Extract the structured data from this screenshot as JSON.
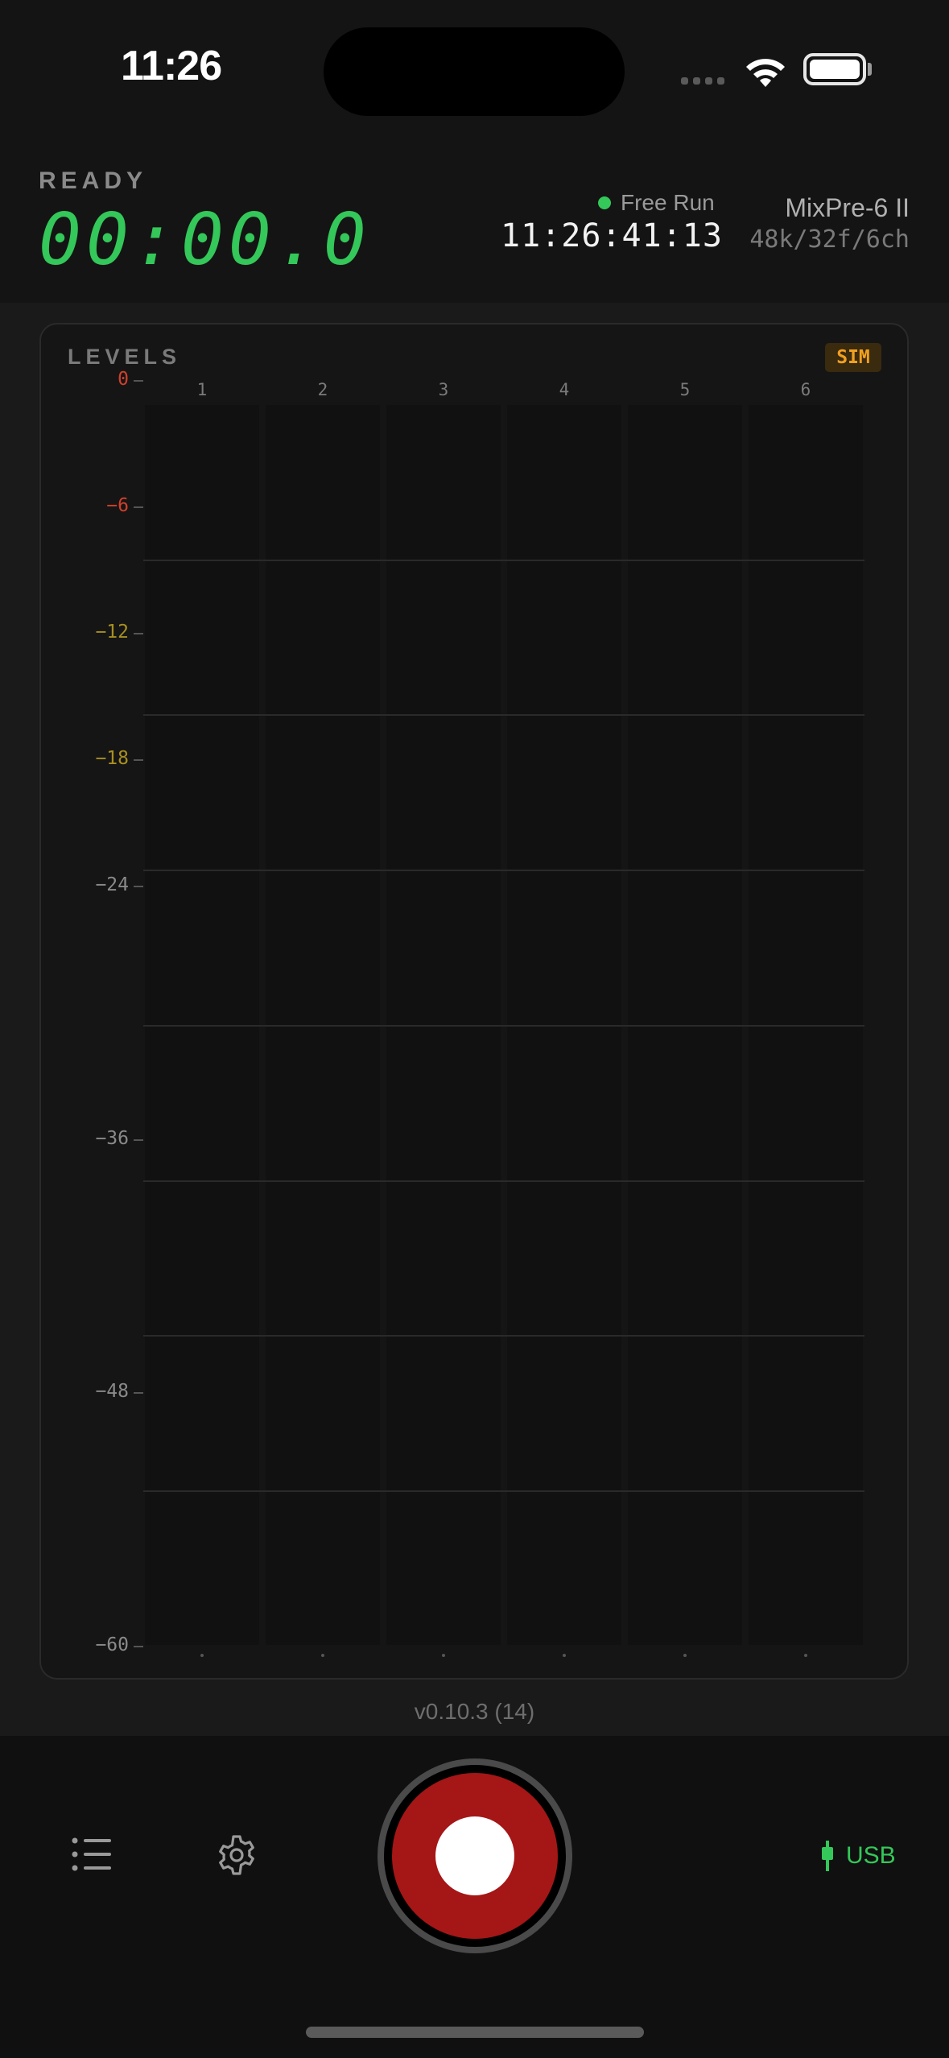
{
  "status_bar": {
    "time": "11:26"
  },
  "header": {
    "state": "READY",
    "elapsed": "00:00.0",
    "timecode_mode": "Free Run",
    "timecode": "11:26:41:13",
    "device_name": "MixPre-6 II",
    "format": "48k/32f/6ch"
  },
  "levels": {
    "title": "LEVELS",
    "badge": "SIM",
    "channels": [
      "1",
      "2",
      "3",
      "4",
      "5",
      "6"
    ],
    "scale": [
      {
        "label": "0",
        "color": "#d0402c"
      },
      {
        "label": "−6",
        "color": "#d0402c"
      },
      {
        "label": "−12",
        "color": "#a89020"
      },
      {
        "label": "−18",
        "color": "#a89020"
      },
      {
        "label": "−24",
        "color": "#8a8a8a"
      },
      {
        "label": "−36",
        "color": "#8a8a8a"
      },
      {
        "label": "−48",
        "color": "#8a8a8a"
      },
      {
        "label": "−60",
        "color": "#8a8a8a"
      }
    ]
  },
  "version": "v0.10.3 (14)",
  "toolbar": {
    "list_icon": "list-icon",
    "settings_icon": "gear-icon",
    "record_icon": "record-button",
    "connection_label": "USB",
    "connection_icon": "usb-plug-icon"
  },
  "colors": {
    "accent_green": "#34c759",
    "record_red": "#a51616",
    "sim_badge": "#f0a020"
  }
}
